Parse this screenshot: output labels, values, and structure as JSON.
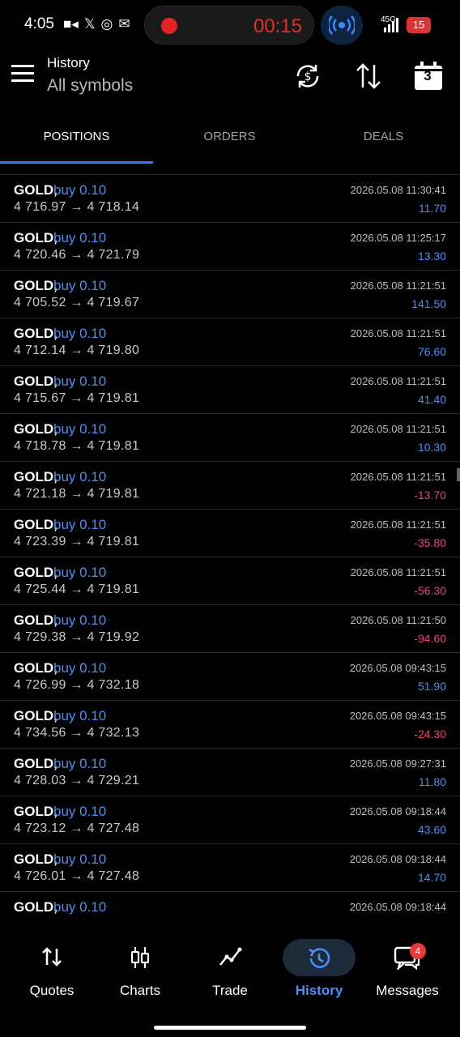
{
  "status_bar": {
    "time": "4:05",
    "record_time": "00:15",
    "network": "45G",
    "battery": "15"
  },
  "header": {
    "title": "History",
    "subtitle": "All symbols",
    "calendar_day": "3"
  },
  "tabs": [
    {
      "label": "POSITIONS",
      "active": true
    },
    {
      "label": "ORDERS",
      "active": false
    },
    {
      "label": "DEALS",
      "active": false
    }
  ],
  "deals": [
    {
      "symbol": "GOLD,",
      "side": "buy 0.10",
      "prices": "4 716.97 → 4 718.14",
      "datetime": "2026.05.08 11:30:41",
      "profit": "11.70"
    },
    {
      "symbol": "GOLD,",
      "side": "buy 0.10",
      "prices": "4 720.46 → 4 721.79",
      "datetime": "2026.05.08 11:25:17",
      "profit": "13.30"
    },
    {
      "symbol": "GOLD,",
      "side": "buy 0.10",
      "prices": "4 705.52 → 4 719.67",
      "datetime": "2026.05.08 11:21:51",
      "profit": "141.50"
    },
    {
      "symbol": "GOLD,",
      "side": "buy 0.10",
      "prices": "4 712.14 → 4 719.80",
      "datetime": "2026.05.08 11:21:51",
      "profit": "76.60"
    },
    {
      "symbol": "GOLD,",
      "side": "buy 0.10",
      "prices": "4 715.67 → 4 719.81",
      "datetime": "2026.05.08 11:21:51",
      "profit": "41.40"
    },
    {
      "symbol": "GOLD,",
      "side": "buy 0.10",
      "prices": "4 718.78 → 4 719.81",
      "datetime": "2026.05.08 11:21:51",
      "profit": "10.30"
    },
    {
      "symbol": "GOLD,",
      "side": "buy 0.10",
      "prices": "4 721.18 → 4 719.81",
      "datetime": "2026.05.08 11:21:51",
      "profit": "-13.70"
    },
    {
      "symbol": "GOLD,",
      "side": "buy 0.10",
      "prices": "4 723.39 → 4 719.81",
      "datetime": "2026.05.08 11:21:51",
      "profit": "-35.80"
    },
    {
      "symbol": "GOLD,",
      "side": "buy 0.10",
      "prices": "4 725.44 → 4 719.81",
      "datetime": "2026.05.08 11:21:51",
      "profit": "-56.30"
    },
    {
      "symbol": "GOLD,",
      "side": "buy 0.10",
      "prices": "4 729.38 → 4 719.92",
      "datetime": "2026.05.08 11:21:50",
      "profit": "-94.60"
    },
    {
      "symbol": "GOLD,",
      "side": "buy 0.10",
      "prices": "4 726.99 → 4 732.18",
      "datetime": "2026.05.08 09:43:15",
      "profit": "51.90"
    },
    {
      "symbol": "GOLD,",
      "side": "buy 0.10",
      "prices": "4 734.56 → 4 732.13",
      "datetime": "2026.05.08 09:43:15",
      "profit": "-24.30"
    },
    {
      "symbol": "GOLD,",
      "side": "buy 0.10",
      "prices": "4 728.03 → 4 729.21",
      "datetime": "2026.05.08 09:27:31",
      "profit": "11.80"
    },
    {
      "symbol": "GOLD,",
      "side": "buy 0.10",
      "prices": "4 723.12 → 4 727.48",
      "datetime": "2026.05.08 09:18:44",
      "profit": "43.60"
    },
    {
      "symbol": "GOLD,",
      "side": "buy 0.10",
      "prices": "4 726.01 → 4 727.48",
      "datetime": "2026.05.08 09:18:44",
      "profit": "14.70"
    },
    {
      "symbol": "GOLD,",
      "side": "buy 0.10",
      "prices": "",
      "datetime": "2026.05.08 09:18:44",
      "profit": ""
    }
  ],
  "bottom_nav": [
    {
      "label": "Quotes",
      "icon": "quotes-arrows-icon",
      "active": false
    },
    {
      "label": "Charts",
      "icon": "candlestick-icon",
      "active": false
    },
    {
      "label": "Trade",
      "icon": "trend-line-icon",
      "active": false
    },
    {
      "label": "History",
      "icon": "history-clock-icon",
      "active": true
    },
    {
      "label": "Messages",
      "icon": "chat-icon",
      "active": false,
      "badge": "4"
    }
  ],
  "colors": {
    "accent": "#4f8ef7",
    "profit_positive": "#4f8ef7",
    "profit_negative": "#e8447a",
    "background": "#000000"
  }
}
